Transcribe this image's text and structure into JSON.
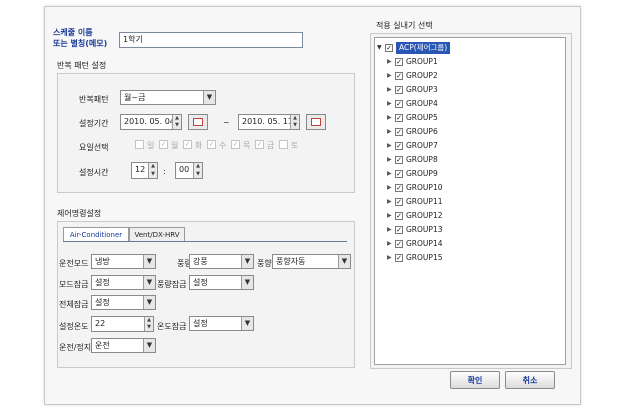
{
  "schedule_name": {
    "label_line1": "스케줄 이름",
    "label_line2": "또는 별칭(메모)",
    "value": "1학기"
  },
  "repeat_pattern": {
    "group_title": "반복 패턴 설정",
    "pattern_label": "반복패턴",
    "pattern_value": "월~금",
    "period_label": "설정기간",
    "start_date": "2010. 05. 04",
    "tilde": "~",
    "end_date": "2010. 05. 11",
    "day_label": "요일선택",
    "days": [
      {
        "label": "일",
        "checked": false
      },
      {
        "label": "월",
        "checked": true
      },
      {
        "label": "화",
        "checked": true
      },
      {
        "label": "수",
        "checked": true
      },
      {
        "label": "목",
        "checked": true
      },
      {
        "label": "금",
        "checked": true
      },
      {
        "label": "토",
        "checked": false
      }
    ],
    "time_label": "설정시간",
    "hour": "12",
    "colon": ":",
    "minute": "00"
  },
  "control": {
    "group_title": "제어명령설정",
    "tabs": [
      "Air-Conditioner",
      "Vent/DX-HRV"
    ],
    "fields": {
      "run_mode_label": "운전모드",
      "run_mode_value": "냉방",
      "airflow_label": "풍량",
      "airflow_value": "강풍",
      "wind_dir_label": "풍향",
      "wind_dir_value": "풍향자동",
      "mode_lock_label": "모드잠금",
      "mode_lock_value": "설정",
      "airflow_lock_label": "풍량잠금",
      "airflow_lock_value": "설정",
      "all_lock_label": "전체잠금",
      "all_lock_value": "설정",
      "set_temp_label": "설정온도",
      "set_temp_value": "22",
      "temp_lock_label": "온도잠금",
      "temp_lock_value": "설정",
      "run_stop_label": "운전/정지",
      "run_stop_value": "운전"
    }
  },
  "unit_select": {
    "title": "적용 실내기 선택",
    "root": "ACP(제어그룹)",
    "groups": [
      "GROUP1",
      "GROUP2",
      "GROUP3",
      "GROUP4",
      "GROUP5",
      "GROUP6",
      "GROUP7",
      "GROUP8",
      "GROUP9",
      "GROUP10",
      "GROUP11",
      "GROUP12",
      "GROUP13",
      "GROUP14",
      "GROUP15"
    ]
  },
  "buttons": {
    "ok": "확인",
    "cancel": "취소"
  },
  "icons": {
    "dropdown": "chevron-down-icon",
    "calendar": "calendar-icon",
    "check": "checkbox-checked-icon"
  }
}
